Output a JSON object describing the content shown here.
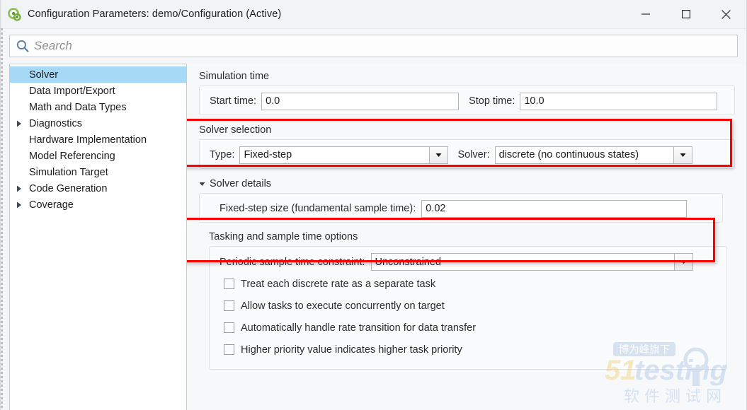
{
  "window": {
    "title": "Configuration Parameters: demo/Configuration (Active)",
    "app_icon": "simulink-icon",
    "controls": {
      "minimize": "minimize-icon",
      "maximize": "maximize-icon",
      "close": "close-icon"
    }
  },
  "search": {
    "icon": "search-icon",
    "placeholder": "Search",
    "value": ""
  },
  "sidebar": {
    "items": [
      {
        "label": "Solver",
        "selected": true,
        "expandable": false
      },
      {
        "label": "Data Import/Export",
        "selected": false,
        "expandable": false
      },
      {
        "label": "Math and Data Types",
        "selected": false,
        "expandable": false
      },
      {
        "label": "Diagnostics",
        "selected": false,
        "expandable": true
      },
      {
        "label": "Hardware Implementation",
        "selected": false,
        "expandable": false
      },
      {
        "label": "Model Referencing",
        "selected": false,
        "expandable": false
      },
      {
        "label": "Simulation Target",
        "selected": false,
        "expandable": false
      },
      {
        "label": "Code Generation",
        "selected": false,
        "expandable": true
      },
      {
        "label": "Coverage",
        "selected": false,
        "expandable": true
      }
    ]
  },
  "main": {
    "simulation_time": {
      "title": "Simulation time",
      "start_label": "Start time:",
      "start_value": "0.0",
      "stop_label": "Stop time:",
      "stop_value": "10.0"
    },
    "solver_selection": {
      "title": "Solver selection",
      "type_label": "Type:",
      "type_value": "Fixed-step",
      "solver_label": "Solver:",
      "solver_value": "discrete (no continuous states)",
      "highlighted": true
    },
    "solver_details": {
      "title": "Solver details",
      "expanded": true,
      "fixed_step_label": "Fixed-step size (fundamental sample time):",
      "fixed_step_value": "0.02",
      "highlighted": true
    },
    "tasking": {
      "title": "Tasking and sample time options",
      "constraint_label": "Periodic sample time constraint:",
      "constraint_value": "Unconstrained",
      "checkboxes": [
        {
          "label": "Treat each discrete rate as a separate task",
          "checked": false
        },
        {
          "label": "Allow tasks to execute concurrently on target",
          "checked": false
        },
        {
          "label": "Automatically handle rate transition for data transfer",
          "checked": false
        },
        {
          "label": "Higher priority value indicates higher task priority",
          "checked": false
        }
      ]
    }
  },
  "watermark": {
    "badge": "博为峰旗下",
    "brand_number": "51",
    "brand_name": "testing",
    "subtitle": "软 件 测 试 网"
  },
  "colors": {
    "selection": "#a6d9f5",
    "annotation_red": "#fc0000",
    "search_icon": "#5b7ea6",
    "app_icon_green": "#76b043"
  }
}
